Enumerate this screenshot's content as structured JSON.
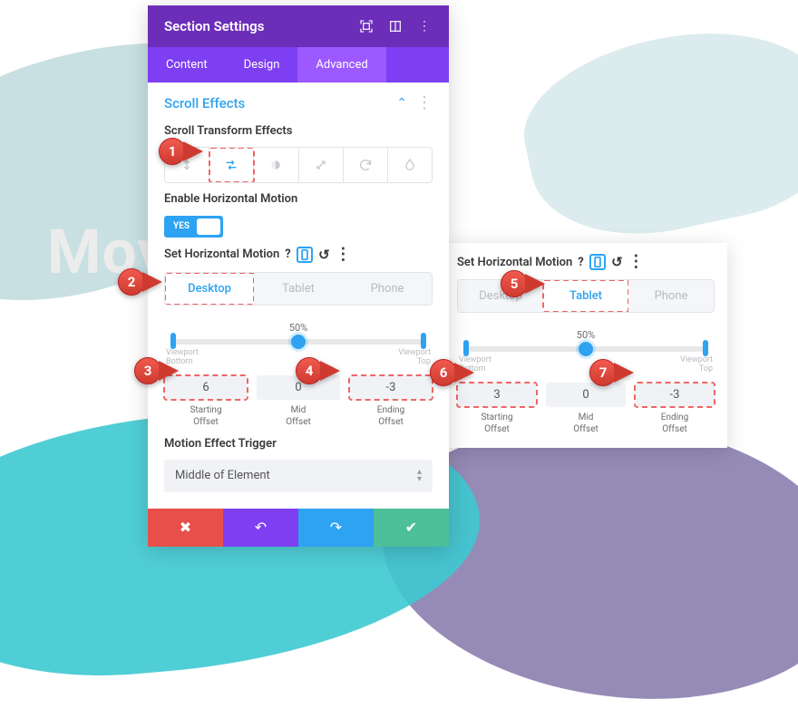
{
  "bg_text": "Mov",
  "header": {
    "title": "Section Settings"
  },
  "tabs": {
    "content": "Content",
    "design": "Design",
    "advanced": "Advanced"
  },
  "group": {
    "title": "Scroll Effects"
  },
  "section1": {
    "label": "Scroll Transform Effects"
  },
  "section2": {
    "label": "Enable Horizontal Motion",
    "toggle": "YES"
  },
  "hm": {
    "label": "Set Horizontal Motion",
    "devices": {
      "desktop": "Desktop",
      "tablet": "Tablet",
      "phone": "Phone"
    },
    "pct": "50%",
    "vp_bottom": "Viewport\nBottom",
    "vp_top": "Viewport\nTop",
    "start_val": "6",
    "mid_val": "0",
    "end_val": "-3",
    "start_cap": "Starting\nOffset",
    "mid_cap": "Mid\nOffset",
    "end_cap": "Ending\nOffset"
  },
  "hm2": {
    "label": "Set Horizontal Motion",
    "pct": "50%",
    "start_val": "3",
    "mid_val": "0",
    "end_val": "-3",
    "start_cap": "Starting\nOffset",
    "mid_cap": "Mid\nOffset",
    "end_cap": "Ending\nOffset",
    "vp_bottom": "Viewport\nBottom",
    "vp_top": "Viewport\nTop"
  },
  "trigger": {
    "label": "Motion Effect Trigger",
    "value": "Middle of Element"
  },
  "callouts": {
    "c1": "1",
    "c2": "2",
    "c3": "3",
    "c4": "4",
    "c5": "5",
    "c6": "6",
    "c7": "7"
  }
}
